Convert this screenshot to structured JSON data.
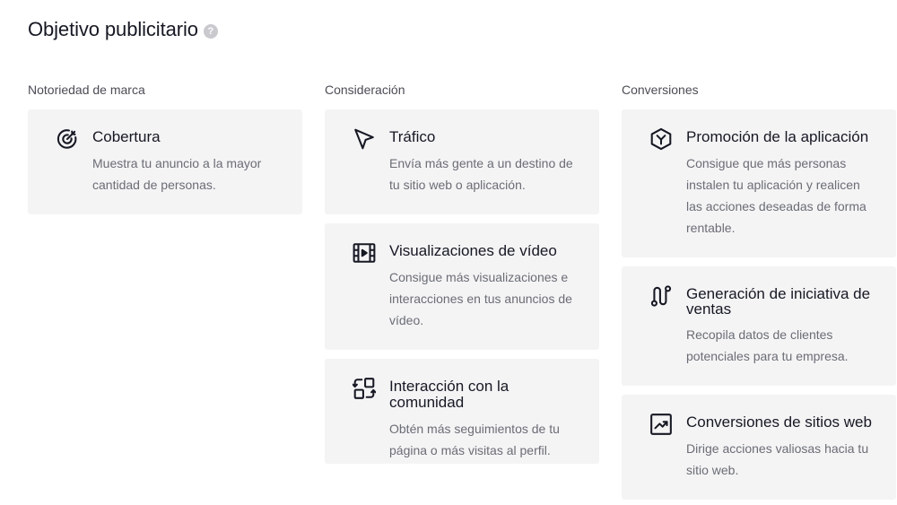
{
  "header": {
    "title": "Objetivo publicitario",
    "help_icon": "question-mark-icon"
  },
  "columns": [
    {
      "heading": "Notoriedad de marca",
      "cards": [
        {
          "icon": "target-icon",
          "title": "Cobertura",
          "description": "Muestra tu anuncio a la mayor cantidad de personas."
        }
      ]
    },
    {
      "heading": "Consideración",
      "cards": [
        {
          "icon": "cursor-arrow-icon",
          "title": "Tráfico",
          "description": "Envía más gente a un destino de tu sitio web o aplicación."
        },
        {
          "icon": "video-film-icon",
          "title": "Visualizaciones de vídeo",
          "description": "Consigue más visualizaciones e interacciones en tus anuncios de vídeo."
        },
        {
          "icon": "community-swap-icon",
          "title": "Interacción con la comunidad",
          "description": "Obtén más seguimientos de tu página o más visitas al perfil."
        }
      ]
    },
    {
      "heading": "Conversiones",
      "cards": [
        {
          "icon": "app-box-icon",
          "title": "Promoción de la aplicación",
          "description": "Consigue que más personas instalen tu aplicación y realicen las acciones deseadas de forma rentable."
        },
        {
          "icon": "lead-path-icon",
          "title": "Generación de iniciativa de ventas",
          "description": "Recopila datos de clientes potenciales para tu empresa."
        },
        {
          "icon": "trend-chart-icon",
          "title": "Conversiones de sitios web",
          "description": "Dirige acciones valiosas hacia tu sitio web."
        }
      ]
    }
  ]
}
